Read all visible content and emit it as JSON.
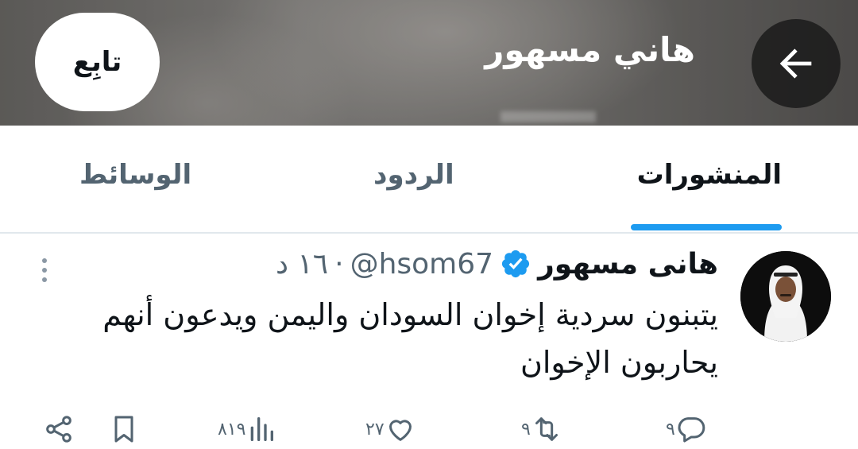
{
  "header": {
    "title": "هاني مسهور",
    "follow_label": "تابِع",
    "back_icon": "back-arrow-icon"
  },
  "tabs": [
    {
      "label": "المنشورات",
      "active": true
    },
    {
      "label": "الردود",
      "active": false
    },
    {
      "label": "الوسائط",
      "active": false
    }
  ],
  "tweet": {
    "author_name": "هانى مسهور",
    "handle": "@hsom67",
    "separator": "·",
    "time": "١٦ د",
    "verified": true,
    "text_line1": "يتبنون سردية إخوان السودان واليمن ويدعون أنهم",
    "text_line2": "يحاربون الإخوان",
    "actions": {
      "replies": "٩",
      "retweets": "٩",
      "likes": "٢٧",
      "views": "٨١٩"
    }
  },
  "colors": {
    "accent": "#1d9bf0",
    "text_primary": "#0f1419",
    "text_secondary": "#536471"
  }
}
